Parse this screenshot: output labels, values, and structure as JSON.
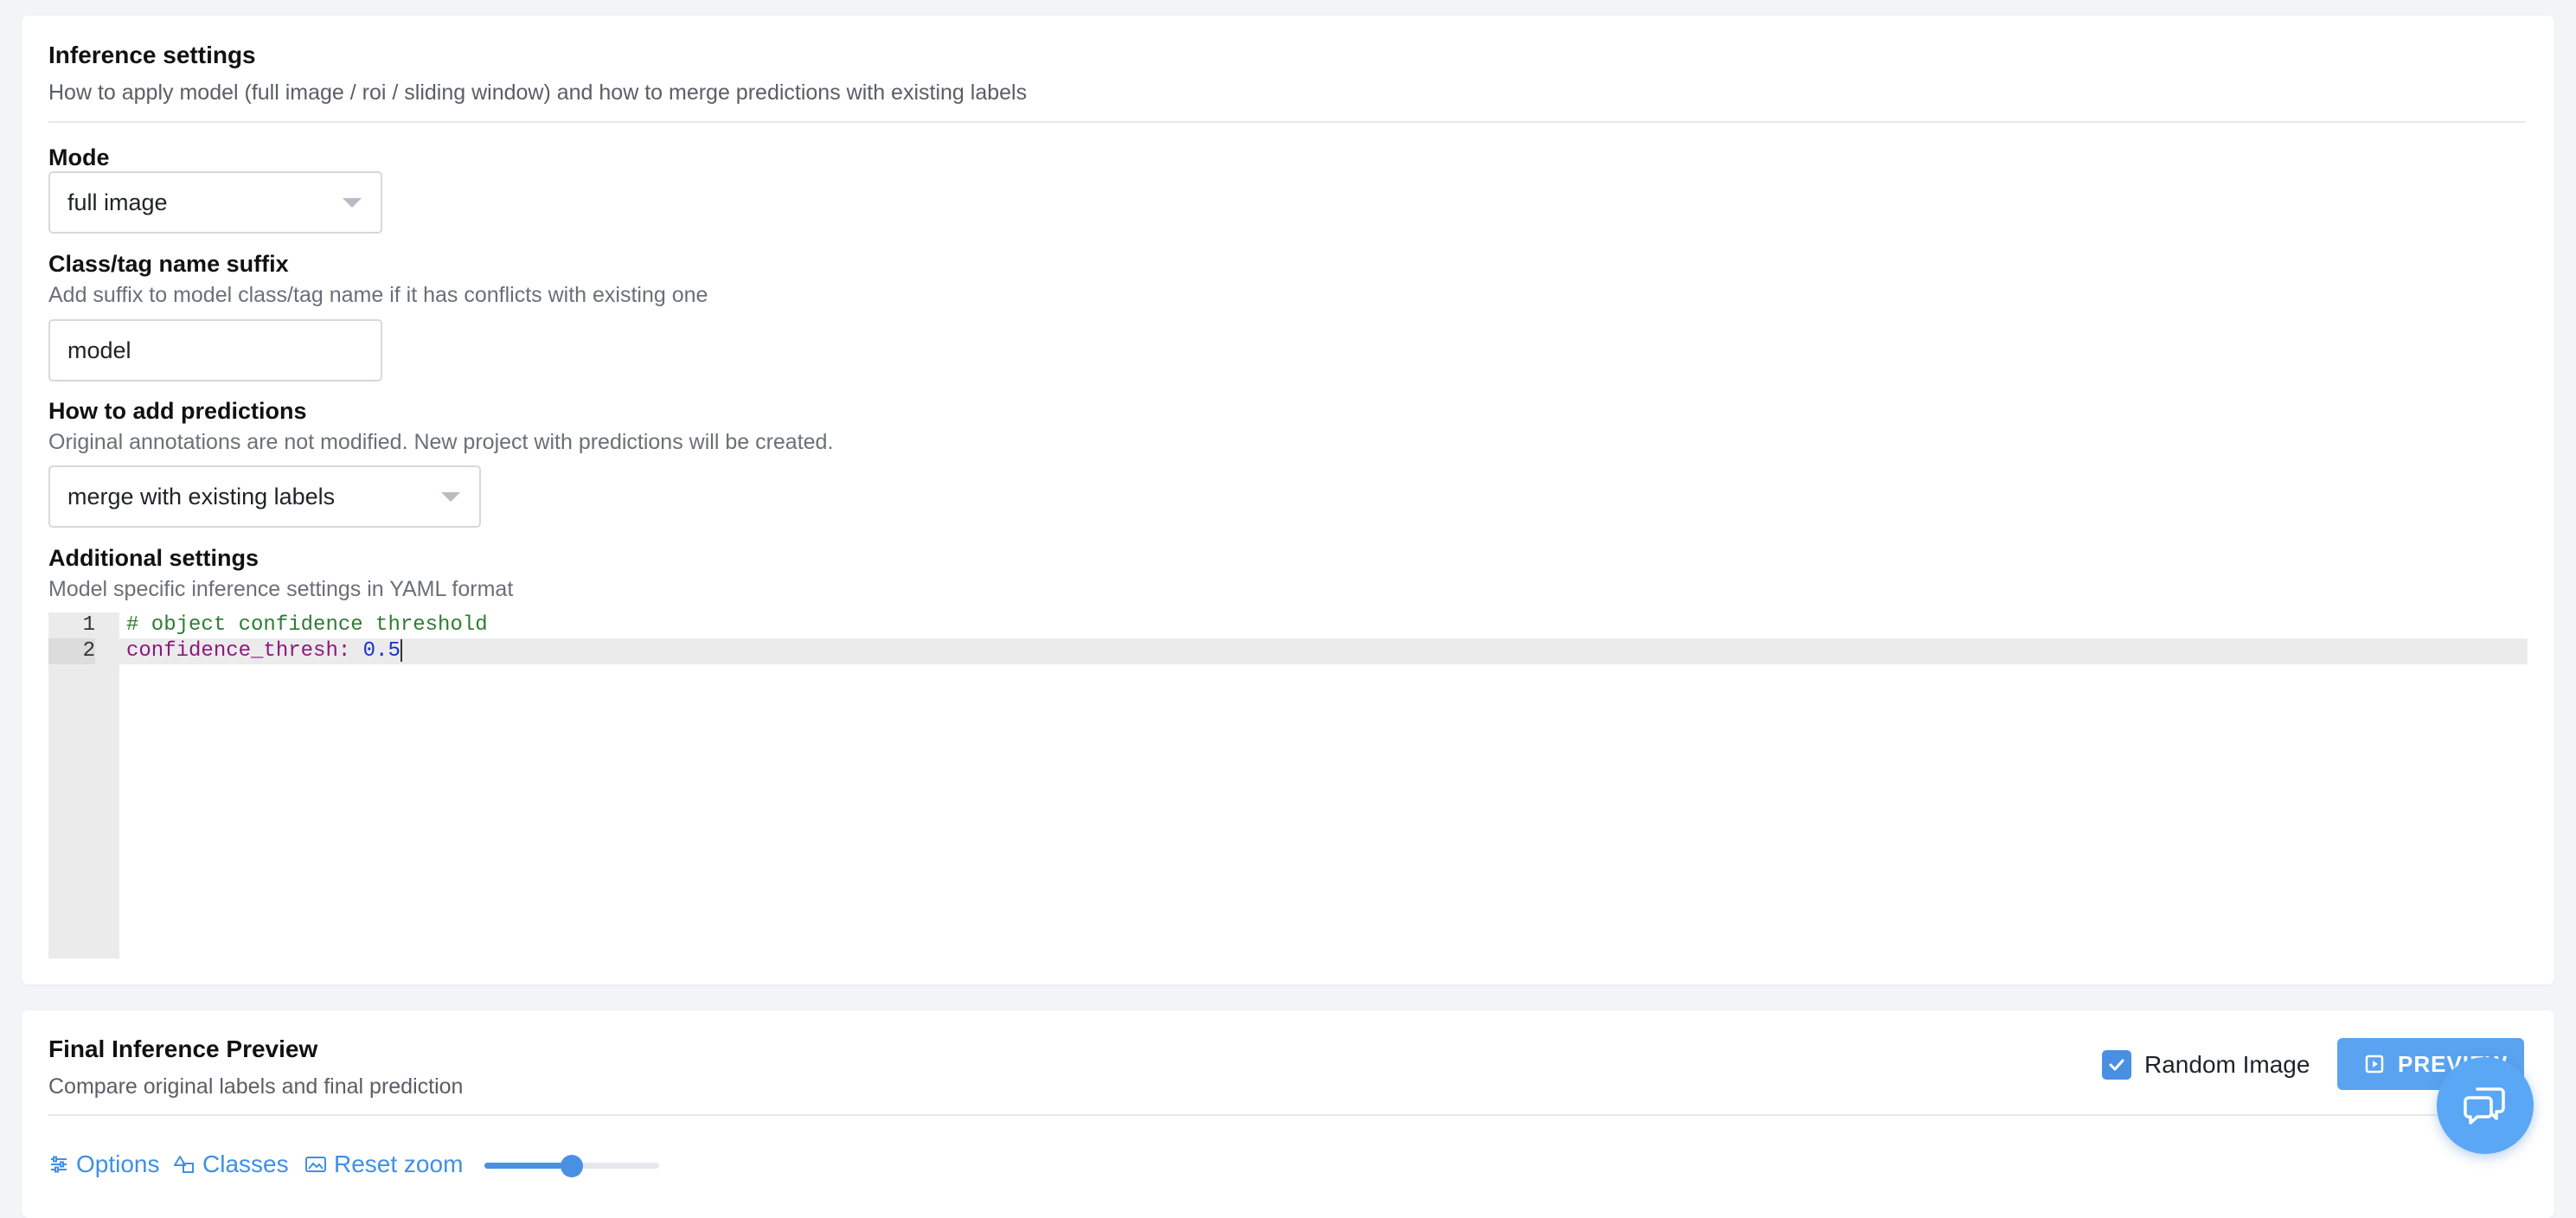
{
  "inference": {
    "title": "Inference settings",
    "subtitle": "How to apply model (full image / roi / sliding window) and how to merge predictions with existing labels",
    "mode": {
      "label": "Mode",
      "value": "full image"
    },
    "suffix": {
      "label": "Class/tag name suffix",
      "description": "Add suffix to model class/tag name if it has conflicts with existing one",
      "value": "model"
    },
    "predictions": {
      "label": "How to add predictions",
      "description": "Original annotations are not modified. New project with predictions will be created.",
      "value": "merge with existing labels"
    },
    "additional": {
      "label": "Additional settings",
      "description": "Model specific inference settings in YAML format",
      "line_numbers": [
        "1",
        "2"
      ],
      "line1": "# object confidence threshold",
      "line2_key": "confidence_thresh:",
      "line2_value": "0.5"
    }
  },
  "preview": {
    "title": "Final Inference Preview",
    "subtitle": "Compare original labels and final prediction",
    "random_image_label": "Random Image",
    "random_image_checked": true,
    "preview_button": "PREVIEW",
    "toolbar": {
      "options": "Options",
      "classes": "Classes",
      "reset_zoom": "Reset zoom",
      "zoom_level": 0.5
    }
  },
  "icons": [
    "chevron-down-icon",
    "check-icon",
    "play-square-icon",
    "sliders-icon",
    "shapes-icon",
    "image-icon",
    "chat-icon"
  ],
  "colors": {
    "accent": "#4a90e2",
    "link": "#3f8fe8"
  }
}
